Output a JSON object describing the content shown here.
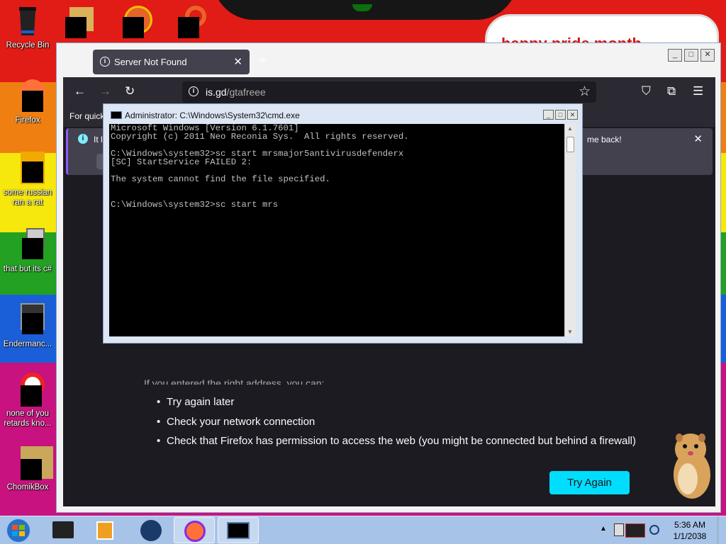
{
  "desktop": {
    "banner_text": "happy pride month",
    "icons": [
      {
        "label": "Recycle Bin"
      },
      {
        "label": "Firefox"
      },
      {
        "label": "some russian ran a rat"
      },
      {
        "label": "that but its c#"
      },
      {
        "label": "Endermanc..."
      },
      {
        "label": "none of you retards kno..."
      },
      {
        "label": "ChomikBox"
      }
    ]
  },
  "browser": {
    "tab_title": "Server Not Found",
    "url_domain": "is.gd",
    "url_path": "/gtafreee",
    "bookmarks_text": "For quick",
    "notification": {
      "left_text": "It l",
      "right_text": "me back!"
    },
    "error_list": [
      "Try again later",
      "Check your network connection",
      "Check that Firefox has permission to access the web (you might be connected but behind a firewall)"
    ],
    "partial_text": "If you entered the right address, you can:",
    "try_again_label": "Try Again",
    "window_controls": [
      "_",
      "□",
      "✕"
    ]
  },
  "cmd": {
    "title": "Administrator: C:\\Windows\\System32\\cmd.exe",
    "lines": [
      "Microsoft Windows [Version 6.1.7601]",
      "Copyright (c) 2011 Neo Reconia Sys.  All rights reserved.",
      "",
      "C:\\Windows\\system32>sc start mrsmajor5antivirusdefenderx",
      "[SC] StartService FAILED 2:",
      "",
      "The system cannot find the file specified.",
      "",
      "",
      "C:\\Windows\\system32>sc start mrs"
    ]
  },
  "taskbar": {
    "time": "5:36 AM",
    "date": "1/1/2038"
  },
  "colors": {
    "try_again": "#00ddff",
    "browser_bg": "#1c1b22",
    "toolbar_bg": "#2b2a33"
  }
}
